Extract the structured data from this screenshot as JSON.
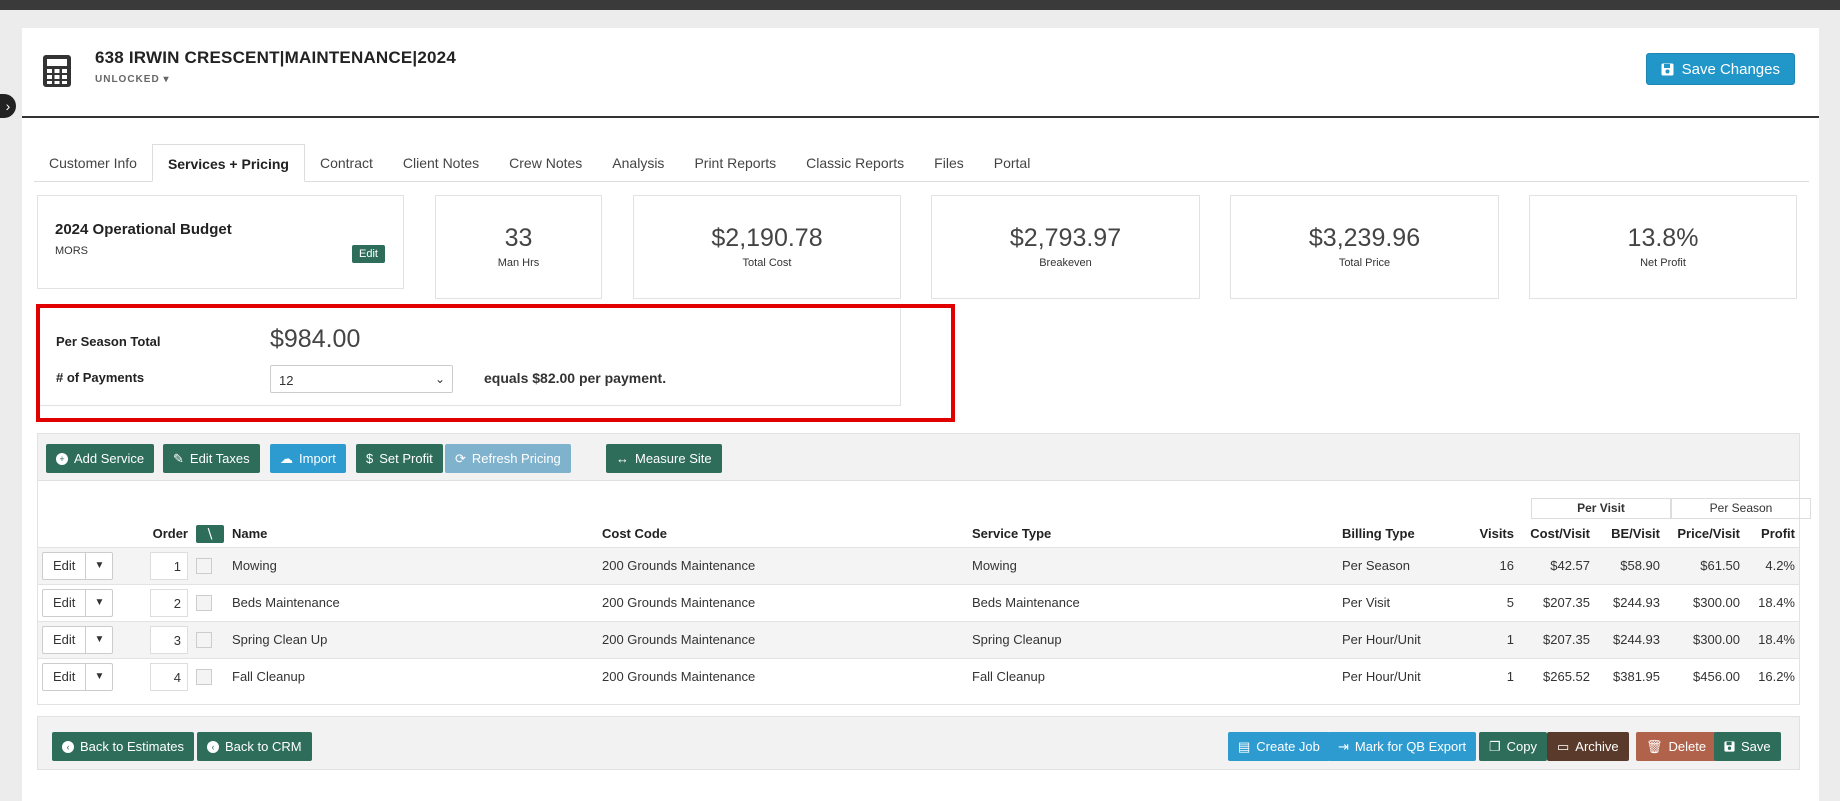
{
  "header": {
    "title": "638 IRWIN CRESCENT|MAINTENANCE|2024",
    "lock_status": "UNLOCKED",
    "save_changes_label": "Save Changes"
  },
  "tabs": [
    {
      "label": "Customer Info"
    },
    {
      "label": "Services + Pricing",
      "active": true
    },
    {
      "label": "Contract"
    },
    {
      "label": "Client Notes"
    },
    {
      "label": "Crew Notes"
    },
    {
      "label": "Analysis"
    },
    {
      "label": "Print Reports"
    },
    {
      "label": "Classic Reports"
    },
    {
      "label": "Files"
    },
    {
      "label": "Portal"
    }
  ],
  "budget": {
    "title": "2024 Operational Budget",
    "subtitle": "MORS",
    "edit_label": "Edit"
  },
  "stats": [
    {
      "value": "33",
      "label": "Man Hrs"
    },
    {
      "value": "$2,190.78",
      "label": "Total Cost"
    },
    {
      "value": "$2,793.97",
      "label": "Breakeven"
    },
    {
      "value": "$3,239.96",
      "label": "Total Price"
    },
    {
      "value": "13.8%",
      "label": "Net Profit"
    }
  ],
  "payments": {
    "season_total_label": "Per Season Total",
    "season_total_value": "$984.00",
    "num_payments_label": "# of Payments",
    "num_payments_value": "12",
    "equals_text": "equals $82.00 per payment."
  },
  "toolbar": {
    "add_service": "Add Service",
    "edit_taxes": "Edit Taxes",
    "import": "Import",
    "set_profit": "Set Profit",
    "refresh_pricing": "Refresh Pricing",
    "measure_site": "Measure Site"
  },
  "view_toggle": {
    "per_visit": "Per Visit",
    "per_season": "Per Season",
    "selected": "Per Visit"
  },
  "table": {
    "headers": {
      "order": "Order",
      "name": "Name",
      "cost_code": "Cost Code",
      "service_type": "Service Type",
      "billing_type": "Billing Type",
      "visits": "Visits",
      "cost_visit": "Cost/Visit",
      "be_visit": "BE/Visit",
      "price_visit": "Price/Visit",
      "profit": "Profit"
    },
    "edit_label": "Edit",
    "rows": [
      {
        "order": "1",
        "name": "Mowing",
        "cost_code": "200 Grounds Maintenance",
        "service_type": "Mowing",
        "billing_type": "Per Season",
        "visits": "16",
        "cost_visit": "$42.57",
        "be_visit": "$58.90",
        "price_visit": "$61.50",
        "profit": "4.2%"
      },
      {
        "order": "2",
        "name": "Beds Maintenance",
        "cost_code": "200 Grounds Maintenance",
        "service_type": "Beds Maintenance",
        "billing_type": "Per Visit",
        "visits": "5",
        "cost_visit": "$207.35",
        "be_visit": "$244.93",
        "price_visit": "$300.00",
        "profit": "18.4%"
      },
      {
        "order": "3",
        "name": "Spring Clean Up",
        "cost_code": "200 Grounds Maintenance",
        "service_type": "Spring Cleanup",
        "billing_type": "Per Hour/Unit",
        "visits": "1",
        "cost_visit": "$207.35",
        "be_visit": "$244.93",
        "price_visit": "$300.00",
        "profit": "18.4%"
      },
      {
        "order": "4",
        "name": "Fall Cleanup",
        "cost_code": "200 Grounds Maintenance",
        "service_type": "Fall Cleanup",
        "billing_type": "Per Hour/Unit",
        "visits": "1",
        "cost_visit": "$265.52",
        "be_visit": "$381.95",
        "price_visit": "$456.00",
        "profit": "16.2%"
      }
    ]
  },
  "footer": {
    "back_estimates": "Back to Estimates",
    "back_crm": "Back to CRM",
    "create_job": "Create Job",
    "mark_qb": "Mark for QB Export",
    "copy": "Copy",
    "archive": "Archive",
    "delete": "Delete",
    "save": "Save"
  },
  "colors": {
    "primary_dark": "#2e6d5a",
    "primary_blue": "#2d9bd0",
    "highlight_red": "#e00000",
    "archive": "#5a3a2a",
    "delete": "#b1624a"
  }
}
